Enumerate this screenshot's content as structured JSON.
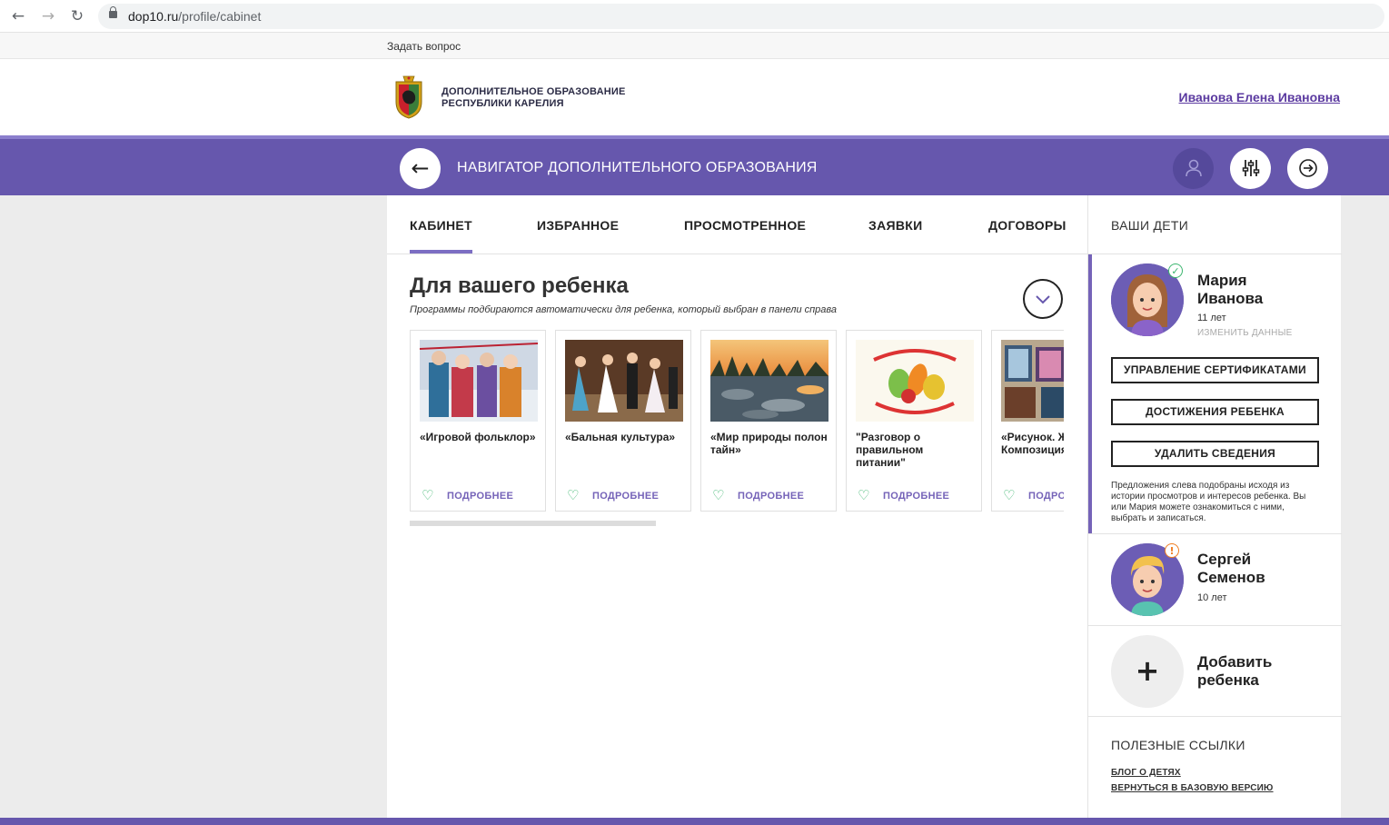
{
  "browser": {
    "url_domain": "dop10.ru",
    "url_path": "/profile/cabinet",
    "back_icon": "arrow-left-icon",
    "forward_icon": "arrow-right-icon",
    "reload_icon": "reload-icon",
    "lock_icon": "lock-icon"
  },
  "top_strip": {
    "ask_link": "Задать вопрос"
  },
  "header": {
    "brand_line1": "ДОПОЛНИТЕЛЬНОЕ ОБРАЗОВАНИЕ",
    "brand_line2": "РЕСПУБЛИКИ КАРЕЛИЯ",
    "user_name": "Иванова Елена Ивановна",
    "logo": "karelia-coat-of-arms"
  },
  "navbar": {
    "title": "НАВИГАТОР ДОПОЛНИТЕЛЬНОГО ОБРАЗОВАНИЯ",
    "back_icon": "arrow-left-icon",
    "profile_icon": "user-icon",
    "filter_icon": "sliders-icon",
    "exit_icon": "logout-icon",
    "accent_color": "#6657ad"
  },
  "tabs": [
    {
      "label": "КАБИНЕТ",
      "active": true
    },
    {
      "label": "ИЗБРАННОЕ",
      "active": false
    },
    {
      "label": "ПРОСМОТРЕННОЕ",
      "active": false
    },
    {
      "label": "ЗАЯВКИ",
      "active": false
    },
    {
      "label": "ДОГОВОРЫ",
      "active": false
    }
  ],
  "recommend": {
    "title": "Для вашего ребенка",
    "subtitle": "Программы подбираются автоматически для ребенка, который выбран в панели справа",
    "collapse_icon": "chevron-down-icon",
    "cards": [
      {
        "title": "«Игровой фольклор»",
        "more": "ПОДРОБНЕЕ",
        "fav_icon": "heart-icon",
        "image": "folk-costumes-photo"
      },
      {
        "title": "«Бальная культура»",
        "more": "ПОДРОБНЕЕ",
        "fav_icon": "heart-icon",
        "image": "ballroom-dance-photo"
      },
      {
        "title": "«Мир природы полон тайн»",
        "more": "ПОДРОБНЕЕ",
        "fav_icon": "heart-icon",
        "image": "river-sunset-photo"
      },
      {
        "title": "\"Разговор о правильном питании\"",
        "more": "ПОДРОБНЕЕ",
        "fav_icon": "heart-icon",
        "image": "healthy-food-poster"
      },
      {
        "title": "«Рисунок. Живопись. Композиция»",
        "more": "ПОДРОБНЕЕ",
        "fav_icon": "heart-icon",
        "image": "paintings-exhibit-photo"
      }
    ],
    "scroll_position": 0.0
  },
  "sidebar": {
    "title": "ВАШИ ДЕТИ",
    "children": [
      {
        "name": "Мария Иванова",
        "age": "11 лет",
        "edit": "ИЗМЕНИТЬ ДАННЫЕ",
        "status_icon": "check-icon",
        "status_color": "#3bb56e",
        "avatar": "girl-avatar",
        "active": true
      },
      {
        "name": "Сергей Семенов",
        "age": "10 лет",
        "status_icon": "warning-icon",
        "status_color": "#ef7d22",
        "avatar": "boy-avatar",
        "active": false
      }
    ],
    "buttons": {
      "certificates": "УПРАВЛЕНИЕ СЕРТИФИКАТАМИ",
      "achievements": "ДОСТИЖЕНИЯ РЕБЕНКА",
      "delete": "УДАЛИТЬ СВЕДЕНИЯ"
    },
    "note": "Предложения слева подобраны исходя из истории просмотров и интересов ребенка. Вы или Мария можете ознакомиться с ними, выбрать и записаться.",
    "add_child": {
      "icon": "plus-icon",
      "label": "Добавить ребенка"
    },
    "links_title": "ПОЛЕЗНЫЕ ССЫЛКИ",
    "links": [
      "БЛОГ О ДЕТЯХ",
      "ВЕРНУТЬСЯ В БАЗОВУЮ ВЕРСИЮ"
    ]
  }
}
